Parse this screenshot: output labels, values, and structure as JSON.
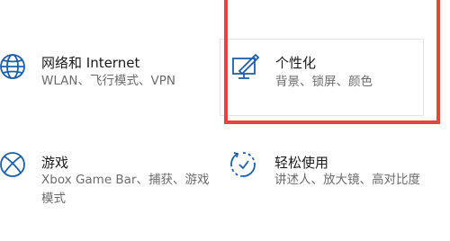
{
  "tiles": {
    "network": {
      "title": "网络和 Internet",
      "desc": "WLAN、飞行模式、VPN",
      "icon": "globe-icon"
    },
    "personalization": {
      "title": "个性化",
      "desc": "背景、锁屏、颜色",
      "icon": "personalization-pen-icon"
    },
    "gaming": {
      "title": "游戏",
      "desc": "Xbox Game Bar、捕获、游戏模式",
      "icon": "xbox-icon"
    },
    "ease": {
      "title": "轻松使用",
      "desc": "讲述人、放大镜、高对比度",
      "icon": "ease-of-access-icon"
    }
  },
  "colors": {
    "icon": "#1f5fa8",
    "highlight": "#e8443a"
  }
}
